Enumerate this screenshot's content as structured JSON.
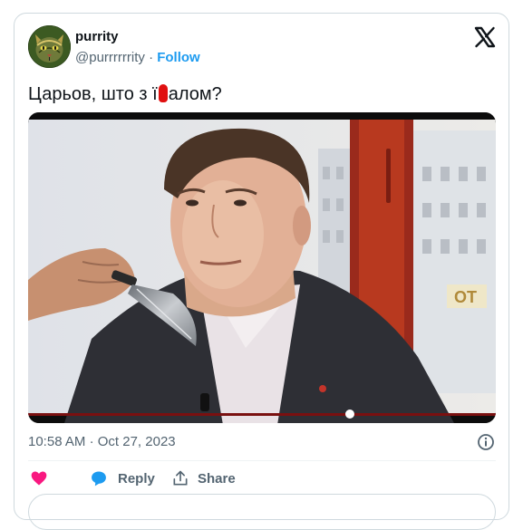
{
  "author": {
    "name": "purrity",
    "handle": "@purrrrrrity",
    "separator": "·",
    "follow_label": "Follow"
  },
  "tweet": {
    "text_before": "Царьов, што з ї",
    "text_after": "алом?"
  },
  "meta": {
    "time": "10:58 AM",
    "separator": "·",
    "date": "Oct 27, 2023"
  },
  "actions": {
    "reply_label": "Reply",
    "share_label": "Share"
  },
  "media": {
    "sign_text": "ОТ"
  },
  "colors": {
    "accent": "#1d9bf0",
    "like": "#f91880",
    "muted": "#536471",
    "redaction": "#e01010"
  },
  "icons": [
    "x-logo-icon",
    "heart-icon",
    "reply-icon",
    "share-icon",
    "info-icon"
  ]
}
